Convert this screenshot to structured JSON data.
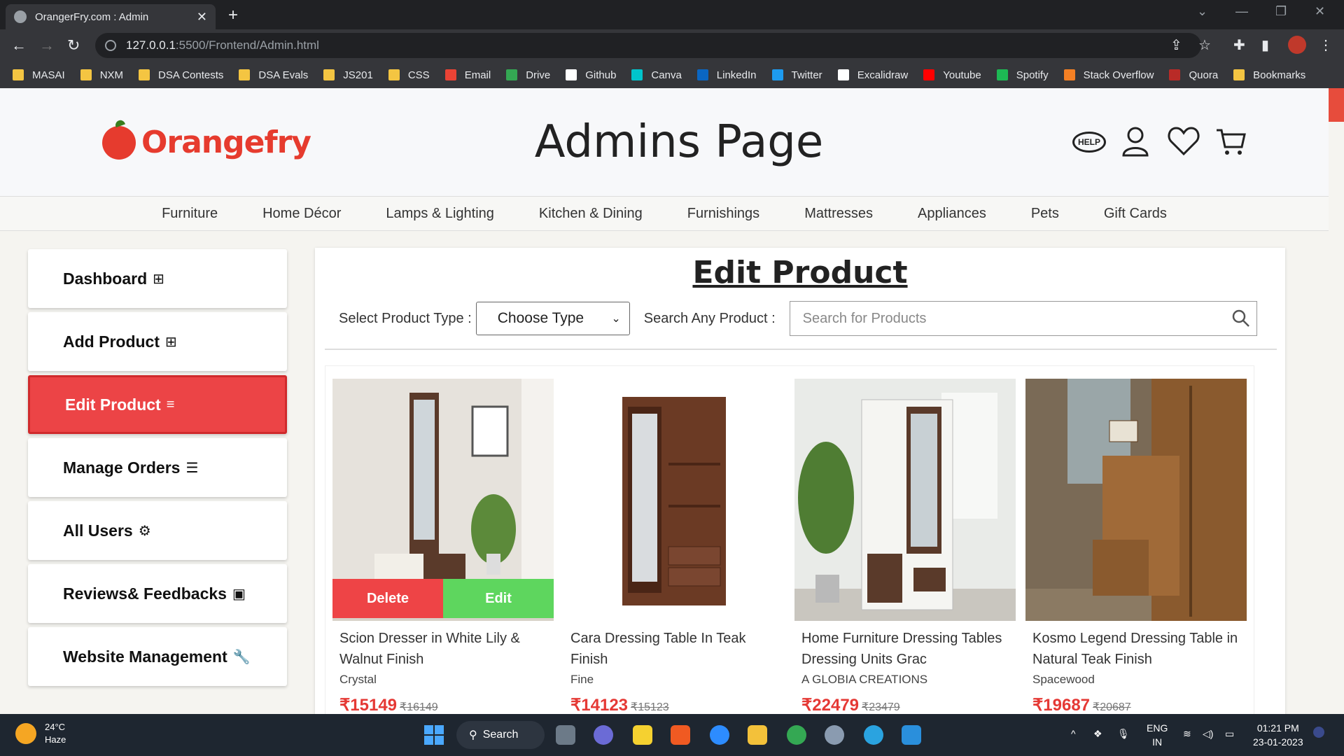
{
  "browser": {
    "tab_title": "OrangerFry.com : Admin",
    "url_host": "127.0.0.1",
    "url_path": ":5500/Frontend/Admin.html",
    "bookmarks": [
      {
        "label": "MASAI",
        "icon": "folder-icon",
        "color": "#f4c542"
      },
      {
        "label": "NXM",
        "icon": "folder-icon",
        "color": "#f4c542"
      },
      {
        "label": "DSA Contests",
        "icon": "folder-icon",
        "color": "#f4c542"
      },
      {
        "label": "DSA Evals",
        "icon": "folder-icon",
        "color": "#f4c542"
      },
      {
        "label": "JS201",
        "icon": "folder-icon",
        "color": "#f4c542"
      },
      {
        "label": "CSS",
        "icon": "folder-icon",
        "color": "#f4c542"
      },
      {
        "label": "Email",
        "icon": "gmail-icon",
        "color": "#ea4335"
      },
      {
        "label": "Drive",
        "icon": "drive-icon",
        "color": "#34a853"
      },
      {
        "label": "Github",
        "icon": "github-icon",
        "color": "#ffffff"
      },
      {
        "label": "Canva",
        "icon": "canva-icon",
        "color": "#00c4cc"
      },
      {
        "label": "LinkedIn",
        "icon": "linkedin-icon",
        "color": "#0a66c2"
      },
      {
        "label": "Twitter",
        "icon": "twitter-icon",
        "color": "#1d9bf0"
      },
      {
        "label": "Excalidraw",
        "icon": "excalidraw-icon",
        "color": "#ffffff"
      },
      {
        "label": "Youtube",
        "icon": "youtube-icon",
        "color": "#ff0000"
      },
      {
        "label": "Spotify",
        "icon": "spotify-icon",
        "color": "#1db954"
      },
      {
        "label": "Stack Overflow",
        "icon": "stackoverflow-icon",
        "color": "#f48024"
      },
      {
        "label": "Quora",
        "icon": "quora-icon",
        "color": "#b92b27"
      },
      {
        "label": "Bookmarks",
        "icon": "folder-icon",
        "color": "#f4c542"
      }
    ]
  },
  "header": {
    "logo_text": "Orangefry",
    "title": "Admins Page",
    "help_label": "HELP"
  },
  "categories": [
    "Furniture",
    "Home Décor",
    "Lamps & Lighting",
    "Kitchen & Dining",
    "Furnishings",
    "Mattresses",
    "Appliances",
    "Pets",
    "Gift Cards"
  ],
  "sidebar": {
    "items": [
      {
        "label": "Dashboard",
        "icon": "grid-icon",
        "glyph": "⊞",
        "active": false
      },
      {
        "label": "Add Product",
        "icon": "plus-box-icon",
        "glyph": "⊞",
        "active": false
      },
      {
        "label": "Edit Product",
        "icon": "edit-list-icon",
        "glyph": "≡",
        "active": true
      },
      {
        "label": "Manage Orders",
        "icon": "list-box-icon",
        "glyph": "☰",
        "active": false
      },
      {
        "label": "All Users",
        "icon": "users-gear-icon",
        "glyph": "⚙",
        "active": false
      },
      {
        "label": "Reviews& Feedbacks",
        "icon": "feedback-icon",
        "glyph": "▣",
        "active": false
      },
      {
        "label": "Website Management",
        "icon": "wrench-icon",
        "glyph": "🔧",
        "active": false
      }
    ]
  },
  "main": {
    "title": "Edit Product",
    "type_label": "Select Product Type :",
    "type_selected": "Choose Type",
    "search_label": "Search Any Product :",
    "search_placeholder": "Search for Products",
    "delete_label": "Delete",
    "edit_label": "Edit",
    "products": [
      {
        "title": "Scion Dresser in White Lily & Walnut Finish",
        "brand": "Crystal",
        "price": "₹15149",
        "mrp": "₹16149"
      },
      {
        "title": "Cara Dressing Table In Teak Finish",
        "brand": "Fine",
        "price": "₹14123",
        "mrp": "₹15123"
      },
      {
        "title": "Home Furniture Dressing Tables Dressing Units Grac",
        "brand": "A GLOBIA CREATIONS",
        "price": "₹22479",
        "mrp": "₹23479"
      },
      {
        "title": "Kosmo Legend Dressing Table in Natural Teak Finish",
        "brand": "Spacewood",
        "price": "₹19687",
        "mrp": "₹20687"
      }
    ]
  },
  "taskbar": {
    "temp": "24°C",
    "weather": "Haze",
    "search_label": "Search",
    "lang_top": "ENG",
    "lang_bottom": "IN",
    "time": "01:21 PM",
    "date": "23-01-2023"
  }
}
